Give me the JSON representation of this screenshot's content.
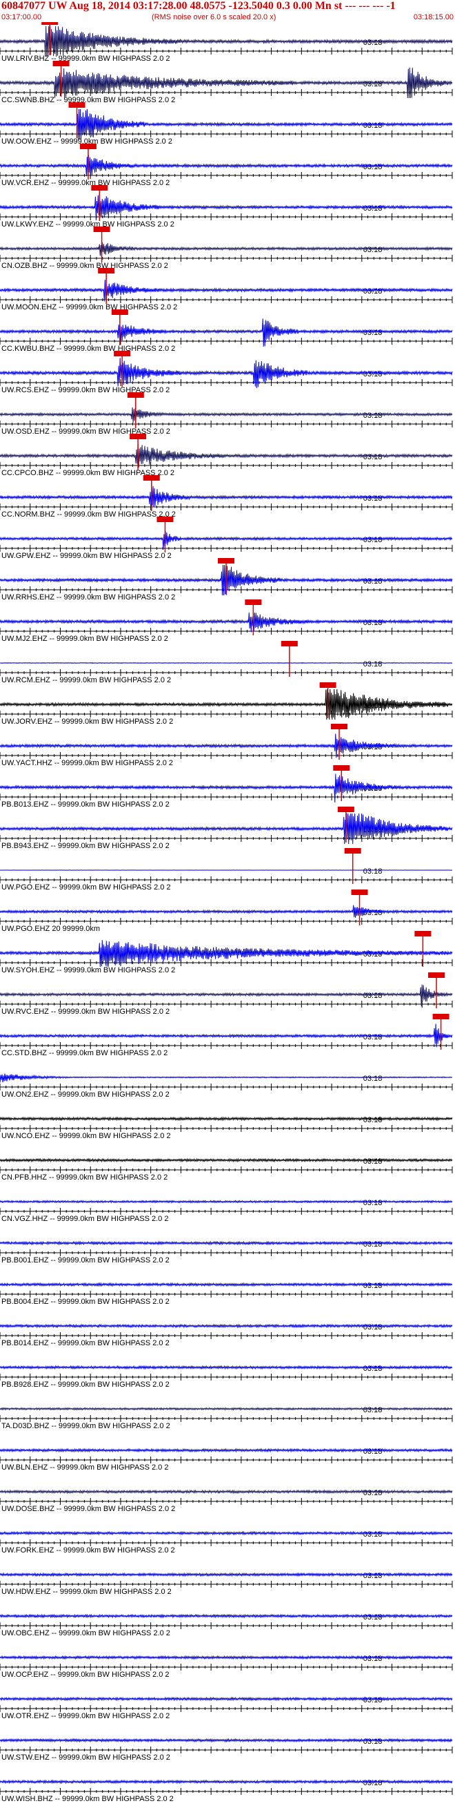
{
  "header": {
    "title": "60847077 UW Aug 18, 2014 03:17:28.00   48.0575 -123.5040  0.3 0.00 Mn st --- --- ---   -1",
    "start_time": "03:17:00.00",
    "end_time": "03:18:15.00",
    "note": "(RMS noise over 6.0 s scaled 20.0 x)"
  },
  "minute_mark": "03:18",
  "colors": {
    "header_text": "#cc0000",
    "pick_box": "#dd0000",
    "trace_blue": "#0000ee",
    "trace_navy": "#1a1a5e",
    "trace_black": "#000000",
    "label": "#000000"
  },
  "traces": [
    {
      "label": "UW.LRIV.BHZ -- 99999.0km BW  HIGHPASS  2.0  2",
      "color": "navy",
      "amp": 0.55,
      "pick": 0.11,
      "burst": [
        0.1,
        0.4,
        1.6
      ],
      "burst2": null
    },
    {
      "label": "CC.SWNB.BHZ -- 99999.0km BW  HIGHPASS  2.0  2",
      "color": "navy",
      "amp": 0.55,
      "pick": 0.135,
      "burst": [
        0.12,
        0.65,
        1.3
      ],
      "burst2": [
        0.9,
        0.99,
        1.8
      ]
    },
    {
      "label": "UW.OOW.EHZ -- 99999.0km BW  HIGHPASS  2.0  2",
      "color": "blue",
      "amp": 0.5,
      "pick": 0.17,
      "burst": [
        0.17,
        0.32,
        2.2
      ],
      "burst2": null
    },
    {
      "label": "UW.VCR.EHZ -- 99999.0km BW  HIGHPASS  2.0  2",
      "color": "blue",
      "amp": 0.5,
      "pick": 0.195,
      "burst": [
        0.19,
        0.3,
        1.2
      ],
      "burst2": null
    },
    {
      "label": "UW.LKWY.EHZ -- 99999.0km BW  HIGHPASS  2.0  2",
      "color": "blue",
      "amp": 0.5,
      "pick": 0.22,
      "burst": [
        0.21,
        0.35,
        1.6
      ],
      "burst2": null
    },
    {
      "label": "CN.OZB.BHZ -- 99999.0km BW  HIGHPASS  2.0  2",
      "color": "navy",
      "amp": 0.45,
      "pick": 0.225,
      "burst": [
        0.22,
        0.3,
        0.9
      ],
      "burst2": null
    },
    {
      "label": "UW.MOON.EHZ -- 99999.0km BW  HIGHPASS  2.0  2",
      "color": "blue",
      "amp": 0.5,
      "pick": 0.235,
      "burst": [
        0.23,
        0.35,
        1.0
      ],
      "burst2": null
    },
    {
      "label": "CC.KWBU.BHZ -- 99999.0km BW  HIGHPASS  2.0  2",
      "color": "blue",
      "amp": 0.5,
      "pick": 0.265,
      "burst": [
        0.26,
        0.36,
        1.1
      ],
      "burst2": [
        0.58,
        0.66,
        1.5
      ]
    },
    {
      "label": "UW.RCS.EHZ -- 99999.0km BW  HIGHPASS  2.0  2",
      "color": "blue",
      "amp": 0.55,
      "pick": 0.27,
      "burst": [
        0.26,
        0.4,
        1.3
      ],
      "burst2": [
        0.56,
        0.68,
        1.7
      ]
    },
    {
      "label": "UW.OSD.EHZ -- 99999.0km BW  HIGHPASS  2.0  2",
      "color": "navy",
      "amp": 0.45,
      "pick": 0.3,
      "burst": [
        0.29,
        0.36,
        0.9
      ],
      "burst2": null
    },
    {
      "label": "CC.CPCO.BHZ -- 99999.0km BW  HIGHPASS  2.0  2",
      "color": "navy",
      "amp": 0.5,
      "pick": 0.305,
      "burst": [
        0.3,
        0.5,
        1.1
      ],
      "burst2": null
    },
    {
      "label": "CC.NORM.BHZ -- 99999.0km BW  HIGHPASS  2.0  2",
      "color": "blue",
      "amp": 0.5,
      "pick": 0.335,
      "burst": [
        0.33,
        0.42,
        1.2
      ],
      "burst2": null
    },
    {
      "label": "UW.GPW.EHZ -- 99999.0km BW  HIGHPASS  2.0  2",
      "color": "blue",
      "amp": 0.45,
      "pick": 0.365,
      "burst": [
        0.36,
        0.4,
        1.3
      ],
      "burst2": null
    },
    {
      "label": "UW.RRHS.EHZ -- 99999.0km BW  HIGHPASS  2.0  2",
      "color": "blue",
      "amp": 0.5,
      "pick": 0.5,
      "burst": [
        0.49,
        0.62,
        1.8
      ],
      "burst2": null
    },
    {
      "label": "UW.MJ2.EHZ -- 99999.0km BW  HIGHPASS  2.0  2",
      "color": "blue",
      "amp": 0.5,
      "pick": 0.56,
      "burst": [
        0.55,
        0.68,
        1.0
      ],
      "burst2": null
    },
    {
      "label": "UW.RCM.EHZ -- 99999.0km BW  HIGHPASS  2.0  2",
      "color": "blue",
      "amp": 0.12,
      "pick": 0.64,
      "burst": null,
      "burst2": null
    },
    {
      "label": "UW.JORV.EHZ -- 99999.0km BW  HIGHPASS  2.0  2",
      "color": "black",
      "amp": 0.5,
      "pick": 0.725,
      "burst": [
        0.72,
        0.99,
        2.0
      ],
      "burst2": null
    },
    {
      "label": "UW.YACT.HHZ -- 99999.0km BW  HIGHPASS  2.0  2",
      "color": "blue",
      "amp": 0.5,
      "pick": 0.75,
      "burst": [
        0.74,
        0.88,
        1.1
      ],
      "burst2": null
    },
    {
      "label": "PB.B013.EHZ -- 99999.0km BW  HIGHPASS  2.0  2",
      "color": "blue",
      "amp": 0.5,
      "pick": 0.755,
      "burst": [
        0.74,
        0.88,
        1.3
      ],
      "burst2": null
    },
    {
      "label": "PB.B943.EHZ -- 99999.0km BW  HIGHPASS  2.0  2",
      "color": "blue",
      "amp": 0.5,
      "pick": 0.765,
      "burst": [
        0.76,
        0.99,
        2.2
      ],
      "burst2": null
    },
    {
      "label": "UW.PGO.EHZ -- 99999.0km BW  HIGHPASS  2.0  2",
      "color": "blue",
      "amp": 0.05,
      "pick": 0.78,
      "burst": null,
      "burst2": null
    },
    {
      "label": "UW.PGO.EHZ 20 99999.0km",
      "color": "blue",
      "amp": 0.45,
      "pick": 0.795,
      "burst": [
        0.78,
        0.84,
        0.9
      ],
      "burst2": null
    },
    {
      "label": "UW.SYOH.EHZ -- 99999.0km BW  HIGHPASS  2.0  2",
      "color": "blue",
      "amp": 0.5,
      "pick": 0.935,
      "burst": [
        0.22,
        0.99,
        1.2
      ],
      "burst2": null
    },
    {
      "label": "UW.RVC.EHZ -- 99999.0km BW  HIGHPASS  2.0  2",
      "color": "navy",
      "amp": 0.45,
      "pick": 0.965,
      "burst": [
        0.93,
        0.99,
        1.2
      ],
      "burst2": null
    },
    {
      "label": "CC.STD.BHZ -- 99999.0km BW  HIGHPASS  2.0  2",
      "color": "blue",
      "amp": 0.45,
      "pick": 0.975,
      "burst": [
        0.96,
        0.99,
        2.0
      ],
      "burst2": null
    },
    {
      "label": "UW.ON2.EHZ -- 99999.0km BW  HIGHPASS  2.0  2",
      "color": "blue",
      "amp": 0.2,
      "pick": null,
      "burst": [
        0.0,
        0.15,
        1.2
      ],
      "burst2": null
    },
    {
      "label": "UW.NCO.EHZ -- 99999.0km BW  HIGHPASS  2.0  2",
      "color": "black",
      "amp": 0.45,
      "pick": null,
      "burst": null,
      "burst2": null
    },
    {
      "label": "CN.PFB.HHZ -- 99999.0km BW  HIGHPASS  2.0  2",
      "color": "black",
      "amp": 0.45,
      "pick": null,
      "burst": null,
      "burst2": null
    },
    {
      "label": "CN.VGZ.HHZ -- 99999.0km BW  HIGHPASS  2.0  2",
      "color": "blue",
      "amp": 0.35,
      "pick": null,
      "burst": null,
      "burst2": null
    },
    {
      "label": "PB.B001.EHZ -- 99999.0km BW  HIGHPASS  2.0  2",
      "color": "blue",
      "amp": 0.45,
      "pick": null,
      "burst": null,
      "burst2": null
    },
    {
      "label": "PB.B004.EHZ -- 99999.0km BW  HIGHPASS  2.0  2",
      "color": "blue",
      "amp": 0.45,
      "pick": null,
      "burst": null,
      "burst2": null
    },
    {
      "label": "PB.B014.EHZ -- 99999.0km BW  HIGHPASS  2.0  2",
      "color": "blue",
      "amp": 0.45,
      "pick": null,
      "burst": null,
      "burst2": null
    },
    {
      "label": "PB.B928.EHZ -- 99999.0km BW  HIGHPASS  2.0  2",
      "color": "blue",
      "amp": 0.45,
      "pick": null,
      "burst": null,
      "burst2": null
    },
    {
      "label": "TA.D03D.BHZ -- 99999.0km BW  HIGHPASS  2.0  2",
      "color": "navy",
      "amp": 0.35,
      "pick": null,
      "burst": null,
      "burst2": null
    },
    {
      "label": "UW.BLN.EHZ -- 99999.0km BW  HIGHPASS  2.0  2",
      "color": "blue",
      "amp": 0.45,
      "pick": null,
      "burst": null,
      "burst2": null
    },
    {
      "label": "UW.DOSE.BHZ -- 99999.0km BW  HIGHPASS  2.0  2",
      "color": "navy",
      "amp": 0.45,
      "pick": null,
      "burst": null,
      "burst2": null
    },
    {
      "label": "UW.FORK.EHZ -- 99999.0km BW  HIGHPASS  2.0  2",
      "color": "blue",
      "amp": 0.45,
      "pick": null,
      "burst": null,
      "burst2": null
    },
    {
      "label": "UW.HDW.EHZ -- 99999.0km BW  HIGHPASS  2.0  2",
      "color": "blue",
      "amp": 0.45,
      "pick": null,
      "burst": null,
      "burst2": null
    },
    {
      "label": "UW.OBC.EHZ -- 99999.0km BW  HIGHPASS  2.0  2",
      "color": "blue",
      "amp": 0.45,
      "pick": null,
      "burst": null,
      "burst2": null
    },
    {
      "label": "UW.OCP.EHZ -- 99999.0km BW  HIGHPASS  2.0  2",
      "color": "blue",
      "amp": 0.45,
      "pick": null,
      "burst": null,
      "burst2": null
    },
    {
      "label": "UW.OTR.EHZ -- 99999.0km BW  HIGHPASS  2.0  2",
      "color": "blue",
      "amp": 0.45,
      "pick": null,
      "burst": null,
      "burst2": null
    },
    {
      "label": "UW.STW.EHZ -- 99999.0km BW  HIGHPASS  2.0  2",
      "color": "blue",
      "amp": 0.45,
      "pick": null,
      "burst": null,
      "burst2": null
    },
    {
      "label": "UW.WISH.BHZ -- 99999.0km BW  HIGHPASS  2.0  2",
      "color": "blue",
      "amp": 0.45,
      "pick": null,
      "burst": null,
      "burst2": null
    }
  ]
}
